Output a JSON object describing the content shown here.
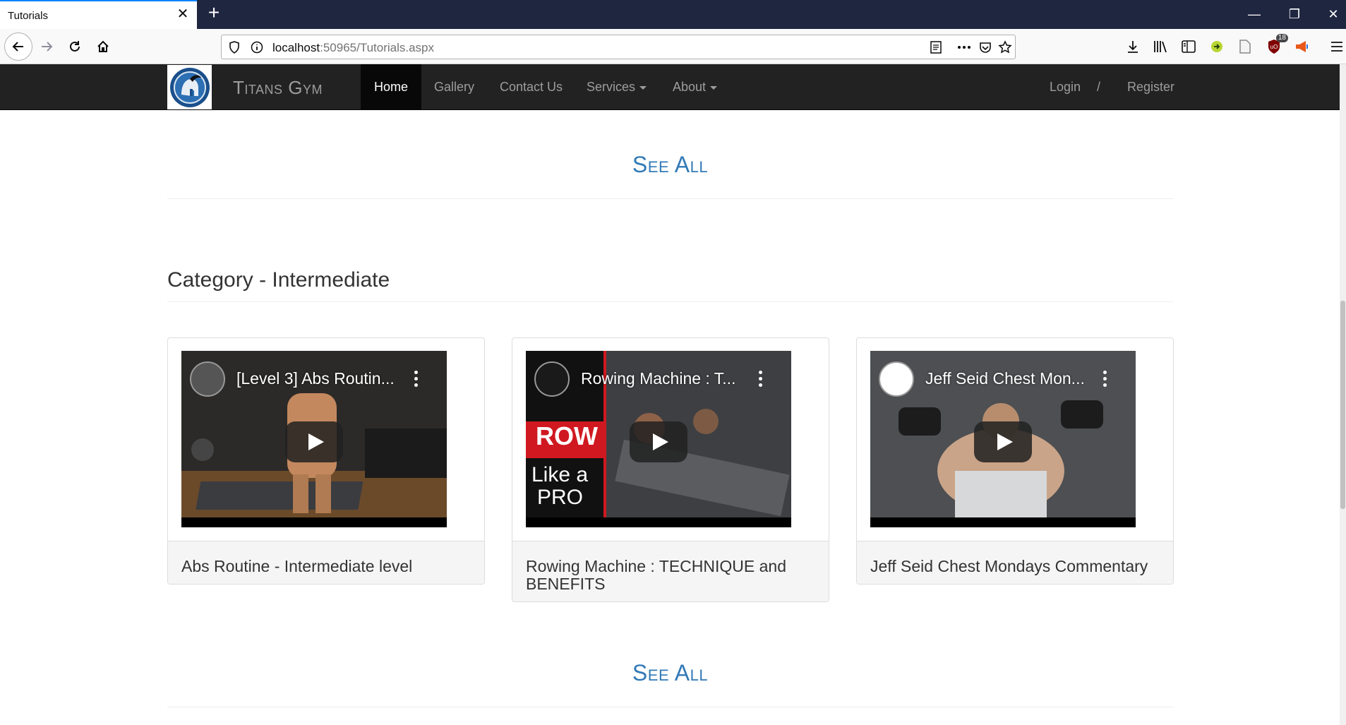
{
  "browser": {
    "tab_title": "Tabs",
    "tab_title_text": "Tutorials",
    "url_host": "localhost",
    "url_rest": ":50965/Tutorials.aspx",
    "badge_count": "18"
  },
  "site": {
    "brand": "Titans Gym",
    "nav": [
      {
        "label": "Home"
      },
      {
        "label": "Gallery"
      },
      {
        "label": "Contact Us"
      },
      {
        "label": "Services"
      },
      {
        "label": "About"
      }
    ],
    "login": "Login",
    "separator": "/",
    "register": "Register"
  },
  "content": {
    "see_all_top": "See All",
    "category": "Category - Intermediate",
    "see_all_bottom": "See All",
    "cards": [
      {
        "video_title": "[Level 3] Abs Routin...",
        "caption": "Abs Routine - Intermediate level"
      },
      {
        "video_title": "Rowing Machine : T...",
        "caption": "Rowing Machine : TECHNIQUE and BENEFITS",
        "thumb_row": "ROW",
        "thumb_like": "Like a",
        "thumb_pro": "PRO"
      },
      {
        "video_title": "Jeff Seid Chest Mon...",
        "caption": "Jeff Seid Chest Mondays Commentary"
      }
    ]
  },
  "colors": {
    "link": "#337ab7",
    "nav_bg": "#222222",
    "chrome_bg": "#1f2640"
  }
}
